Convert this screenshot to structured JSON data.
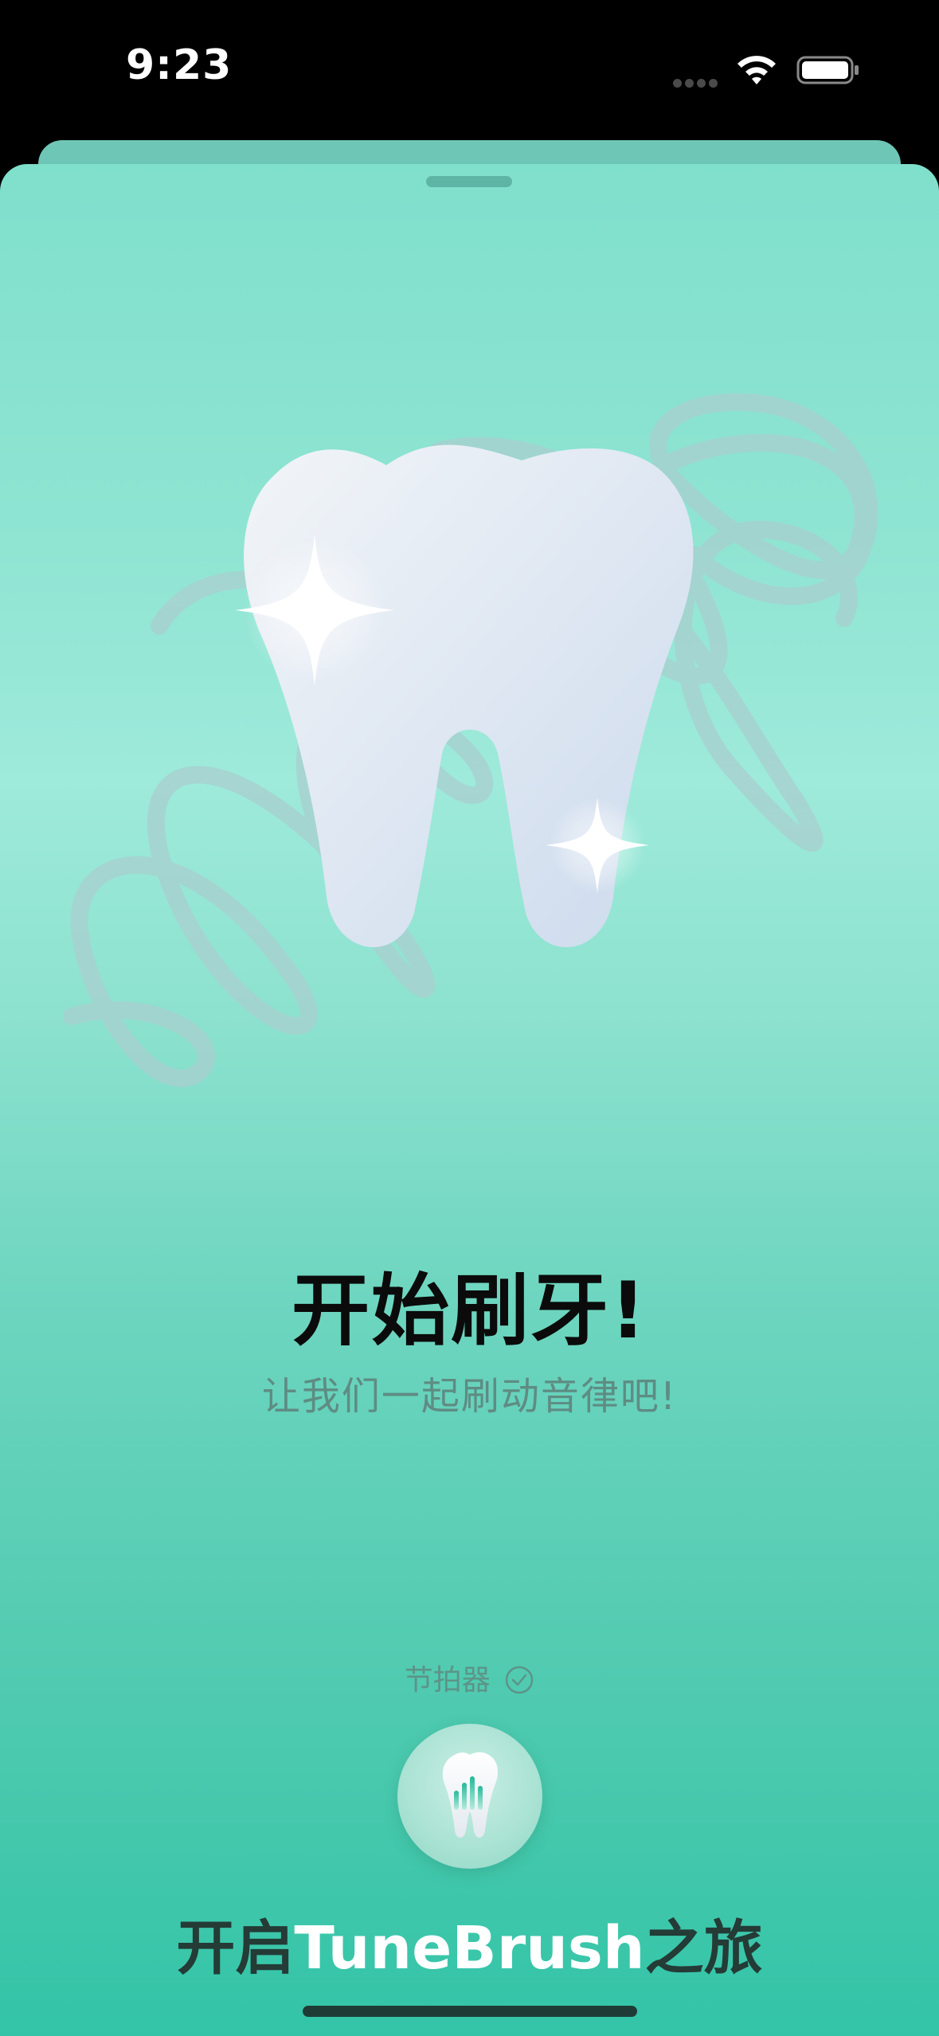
{
  "status_bar": {
    "time": "9:23",
    "wifi_icon": "wifi-icon",
    "battery_icon": "battery-icon",
    "signal_icon": "signal-dots-icon"
  },
  "sheet": {
    "grabber_icon": "sheet-grabber",
    "illustration_icon": "sparkling-tooth-icon",
    "title": "开始刷牙!",
    "subtitle": "让我们一起刷动音律吧!",
    "metronome_label": "节拍器",
    "metronome_icon": "check-circle-icon",
    "app_button_icon": "tooth-soundwave-icon",
    "cta": {
      "prefix": "开启",
      "brand": "TuneBrush",
      "suffix": "之旅"
    }
  },
  "colors": {
    "sheet_top": "#7fe0cc",
    "sheet_bottom": "#33c4a7",
    "brand_text": "#ffffff",
    "dark_text": "#243b36"
  }
}
